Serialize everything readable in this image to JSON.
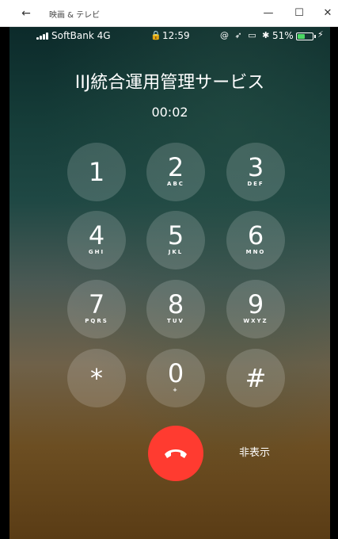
{
  "window": {
    "title": "映画 & テレビ",
    "back_icon": "←",
    "minimize_icon": "—",
    "maximize_icon": "☐",
    "close_icon": "✕"
  },
  "status_bar": {
    "carrier": "SoftBank  4G",
    "time": "12:59",
    "lock_icon": "🔒",
    "icons": "@ ➶ ▭ ✱",
    "battery_percent": "51%",
    "battery_level": 0.51,
    "charge_icon": "⚡"
  },
  "call": {
    "name": "IIJ統合運用管理サービス",
    "duration": "00:02"
  },
  "keypad": [
    {
      "digit": "1",
      "letters": ""
    },
    {
      "digit": "2",
      "letters": "ABC"
    },
    {
      "digit": "3",
      "letters": "DEF"
    },
    {
      "digit": "4",
      "letters": "GHI"
    },
    {
      "digit": "5",
      "letters": "JKL"
    },
    {
      "digit": "6",
      "letters": "MNO"
    },
    {
      "digit": "7",
      "letters": "PQRS"
    },
    {
      "digit": "8",
      "letters": "TUV"
    },
    {
      "digit": "9",
      "letters": "WXYZ"
    },
    {
      "digit": "*",
      "letters": ""
    },
    {
      "digit": "0",
      "letters": "+"
    },
    {
      "digit": "#",
      "letters": ""
    }
  ],
  "actions": {
    "hide_label": "非表示"
  },
  "colors": {
    "end_call": "#ff3b30",
    "battery": "#4cd964"
  }
}
